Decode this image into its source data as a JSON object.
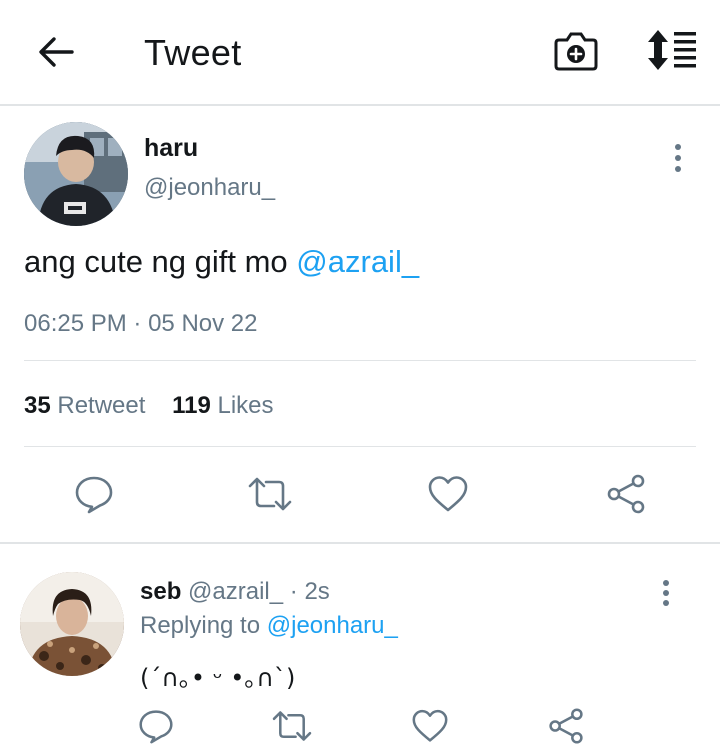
{
  "header": {
    "title": "Tweet",
    "back_icon": "arrow-left-icon",
    "camera_icon": "camera-plus-icon",
    "sort_icon": "sort-list-icon"
  },
  "tweet": {
    "author_name": "haru",
    "author_handle": "@jeonharu_",
    "text_plain": "ang cute ng gift mo ",
    "text_mention": "@azrail_",
    "time": "06:25 PM",
    "separator": "·",
    "date": "05 Nov 22",
    "retweet_count": "35",
    "retweet_label": "Retweet",
    "likes_count": "119",
    "likes_label": "Likes"
  },
  "reply": {
    "author_name": "seb",
    "author_handle": "@azrail_",
    "separator": "·",
    "age": "2s",
    "replying_prefix": "Replying to ",
    "replying_handle": "@jeonharu_",
    "text": "(´∩｡• ᵕ •｡∩`)"
  },
  "colors": {
    "accent": "#1da1f2",
    "secondary_text": "#657786",
    "primary_text": "#14171a",
    "divider": "#e1e4e6"
  }
}
